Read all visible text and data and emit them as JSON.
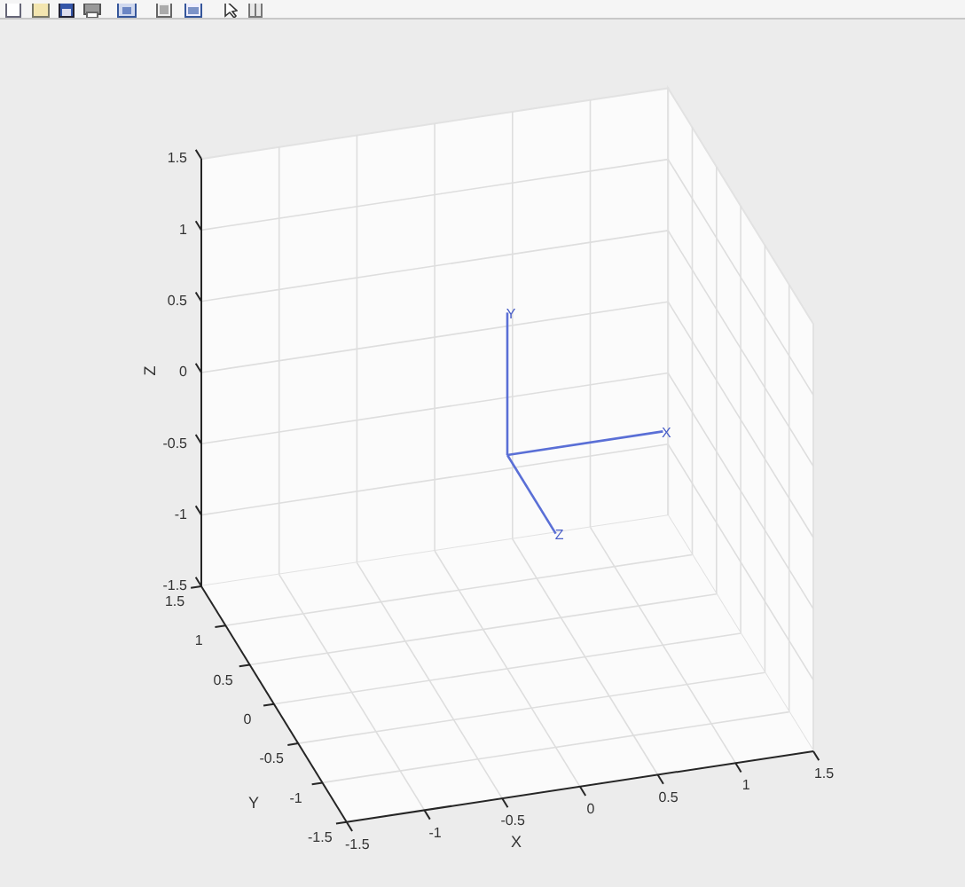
{
  "axes": {
    "x": {
      "label": "X",
      "ticks": [
        "-1.5",
        "-1",
        "-0.5",
        "0",
        "0.5",
        "1",
        "1.5"
      ]
    },
    "y": {
      "label": "Y",
      "ticks": [
        "1.5",
        "1",
        "0.5",
        "0",
        "-0.5",
        "-1",
        "-1.5"
      ]
    },
    "z": {
      "label": "Z",
      "ticks": [
        "1.5",
        "1",
        "0.5",
        "0",
        "-0.5",
        "-1",
        "-1.5"
      ]
    }
  },
  "triad": [
    {
      "label": "X"
    },
    {
      "label": "Y"
    },
    {
      "label": "Z"
    }
  ]
}
